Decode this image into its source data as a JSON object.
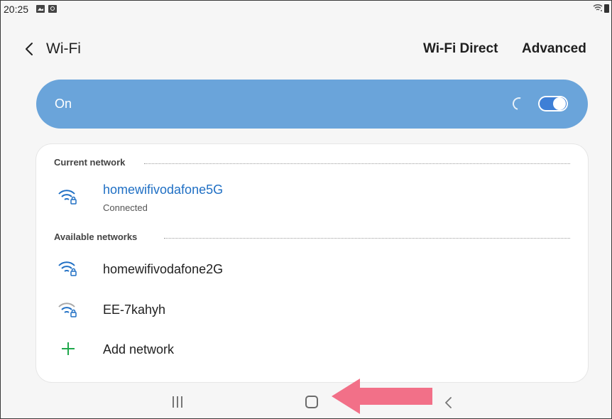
{
  "status_bar": {
    "time": "20:25",
    "icons": [
      "gallery-icon",
      "screen-recorder-icon",
      "wifi-icon",
      "battery-icon"
    ]
  },
  "header": {
    "back_icon": "chevron-left-icon",
    "title": "Wi-Fi",
    "wifi_direct_label": "Wi-Fi Direct",
    "advanced_label": "Advanced"
  },
  "master_switch": {
    "label": "On",
    "state": "on",
    "scanning_spinner": true,
    "bar_color": "#6aa4da",
    "toggle_color": "#3e7fd6"
  },
  "current_network": {
    "header": "Current network",
    "name": "homewifivodafone5G",
    "status": "Connected",
    "icon": "wifi-lock-icon",
    "name_color": "#1f6fc4"
  },
  "available_networks": {
    "header": "Available networks",
    "items": [
      {
        "name": "homewifivodafone2G",
        "icon": "wifi-lock-icon",
        "signal": "full"
      },
      {
        "name": "EE-7kahyh",
        "icon": "wifi-lock-icon",
        "signal": "weak"
      }
    ],
    "add_label": "Add network",
    "add_color": "#20a84c"
  },
  "nav_bar": {
    "buttons": [
      "recents-icon",
      "home-icon",
      "back-icon"
    ]
  },
  "annotation": {
    "arrow_color": "#f27088",
    "points_to": "home-button"
  }
}
